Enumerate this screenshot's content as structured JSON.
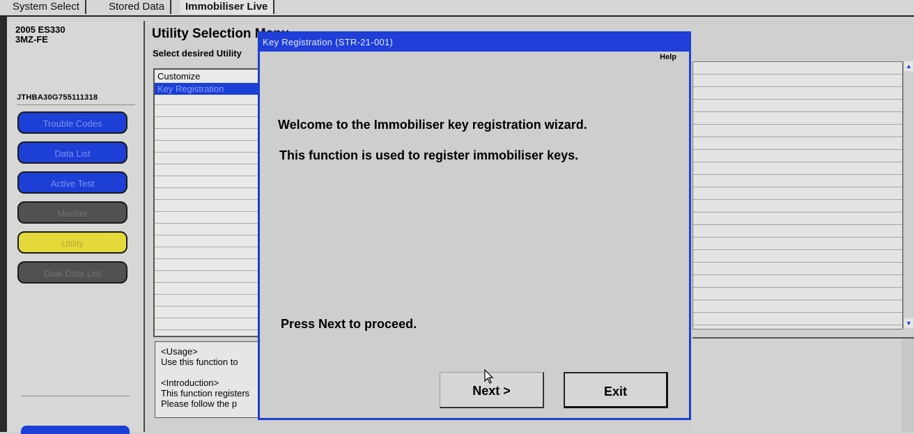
{
  "tabs": [
    "System Select",
    "Stored Data",
    "Immobiliser Live"
  ],
  "vehicle": {
    "model": "2005 ES330",
    "engine": "3MZ-FE",
    "vin": "JTHBA30G755111318"
  },
  "nav": [
    "Trouble Codes",
    "Data List",
    "Active Test",
    "Monitor",
    "Utility",
    "Dual Data List"
  ],
  "main": {
    "title": "Utility Selection Menu",
    "subtitle": "Select desired Utility",
    "list": [
      "Customize",
      "Key Registration"
    ],
    "usage": [
      "<Usage>",
      "Use this function to",
      "",
      "<Introduction>",
      "This function registers",
      "Please follow the p"
    ]
  },
  "dialog": {
    "title": "Key Registration (STR-21-001)",
    "help": "Help",
    "line1": "Welcome to the Immobiliser key registration wizard.",
    "line2": "This function is used to register immobiliser keys.",
    "line3": "Press Next to proceed.",
    "next_label": "Next >",
    "exit_label": "Exit"
  },
  "colors": {
    "accent": "#1c3fd6",
    "utility": "#e4d93a",
    "disabled": "#4f5152"
  }
}
